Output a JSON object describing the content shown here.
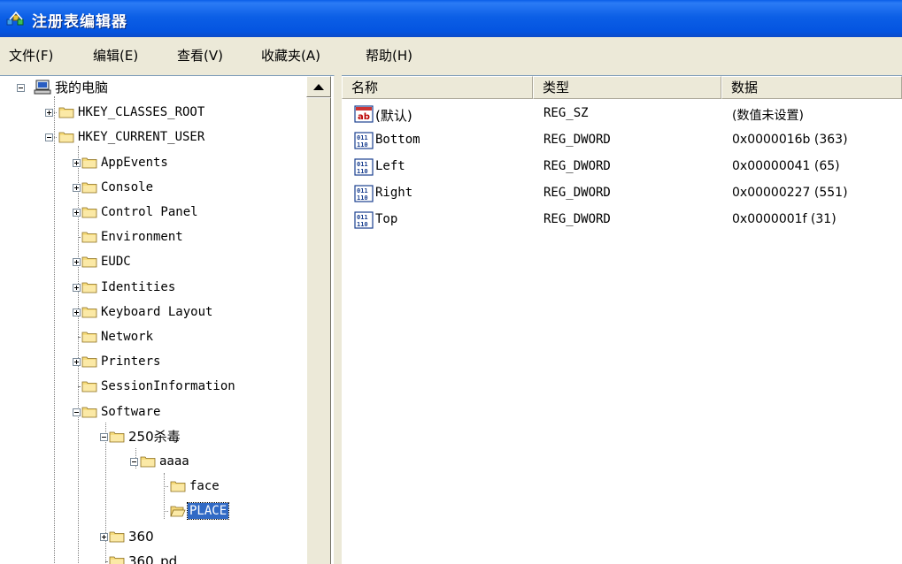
{
  "window": {
    "title": "注册表编辑器",
    "icon": "regedit-icon"
  },
  "menu": [
    {
      "label": "文件(F)"
    },
    {
      "label": "编辑(E)"
    },
    {
      "label": "查看(V)"
    },
    {
      "label": "收藏夹(A)"
    },
    {
      "label": "帮助(H)"
    }
  ],
  "tree": {
    "root": {
      "label": "我的电脑",
      "icon": "computer-icon",
      "expanded": true
    },
    "nodes": [
      {
        "label": "HKEY_CLASSES_ROOT",
        "level": 1,
        "expander": "plus"
      },
      {
        "label": "HKEY_CURRENT_USER",
        "level": 1,
        "expander": "minus"
      },
      {
        "label": "AppEvents",
        "level": 2,
        "expander": "plus"
      },
      {
        "label": "Console",
        "level": 2,
        "expander": "plus"
      },
      {
        "label": "Control Panel",
        "level": 2,
        "expander": "plus"
      },
      {
        "label": "Environment",
        "level": 2,
        "expander": "none"
      },
      {
        "label": "EUDC",
        "level": 2,
        "expander": "plus"
      },
      {
        "label": "Identities",
        "level": 2,
        "expander": "plus"
      },
      {
        "label": "Keyboard Layout",
        "level": 2,
        "expander": "plus"
      },
      {
        "label": "Network",
        "level": 2,
        "expander": "none"
      },
      {
        "label": "Printers",
        "level": 2,
        "expander": "plus"
      },
      {
        "label": "SessionInformation",
        "level": 2,
        "expander": "none"
      },
      {
        "label": "Software",
        "level": 2,
        "expander": "minus"
      },
      {
        "label": "250杀毒",
        "level": 3,
        "expander": "minus"
      },
      {
        "label": "aaaa",
        "level": 4,
        "expander": "minus"
      },
      {
        "label": "face",
        "level": 5,
        "expander": "none"
      },
      {
        "label": "PLACE",
        "level": 5,
        "expander": "none",
        "selected": true
      },
      {
        "label": "360",
        "level": 3,
        "expander": "plus"
      },
      {
        "label": "360_pd",
        "level": 3,
        "expander": "none"
      }
    ]
  },
  "list": {
    "columns": {
      "name": "名称",
      "type": "类型",
      "data": "数据"
    },
    "rows": [
      {
        "icon": "string-value-icon",
        "name": "(默认)",
        "type": "REG_SZ",
        "data": "(数值未设置)"
      },
      {
        "icon": "dword-value-icon",
        "name": "Bottom",
        "type": "REG_DWORD",
        "data": "0x0000016b (363)"
      },
      {
        "icon": "dword-value-icon",
        "name": "Left",
        "type": "REG_DWORD",
        "data": "0x00000041 (65)"
      },
      {
        "icon": "dword-value-icon",
        "name": "Right",
        "type": "REG_DWORD",
        "data": "0x00000227 (551)"
      },
      {
        "icon": "dword-value-icon",
        "name": "Top",
        "type": "REG_DWORD",
        "data": "0x0000001f (31)"
      }
    ]
  }
}
